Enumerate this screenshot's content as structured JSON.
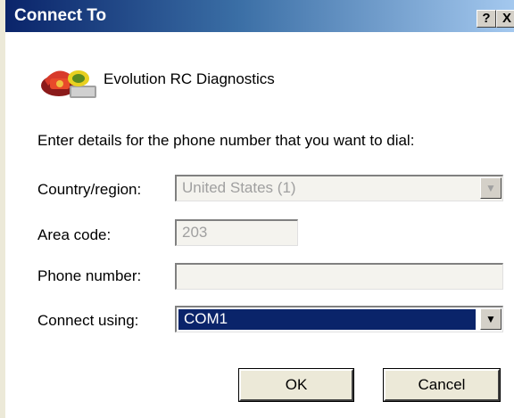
{
  "window": {
    "title": "Connect To",
    "help_button": "?",
    "close_button": "X"
  },
  "app": {
    "name": "Evolution RC Diagnostics",
    "icon": "phone-icon"
  },
  "instruction": "Enter details for the phone number that you want to dial:",
  "form": {
    "country_label": "Country/region:",
    "country_value": "United States (1)",
    "area_label": "Area code:",
    "area_value": "203",
    "phone_label": "Phone number:",
    "phone_value": "",
    "connect_label": "Connect using:",
    "connect_value": "COM1"
  },
  "buttons": {
    "ok": "OK",
    "cancel": "Cancel"
  },
  "colors": {
    "title_bar": "#0a246a",
    "selection": "#0a246a",
    "dialog_face": "#ece9d8"
  }
}
